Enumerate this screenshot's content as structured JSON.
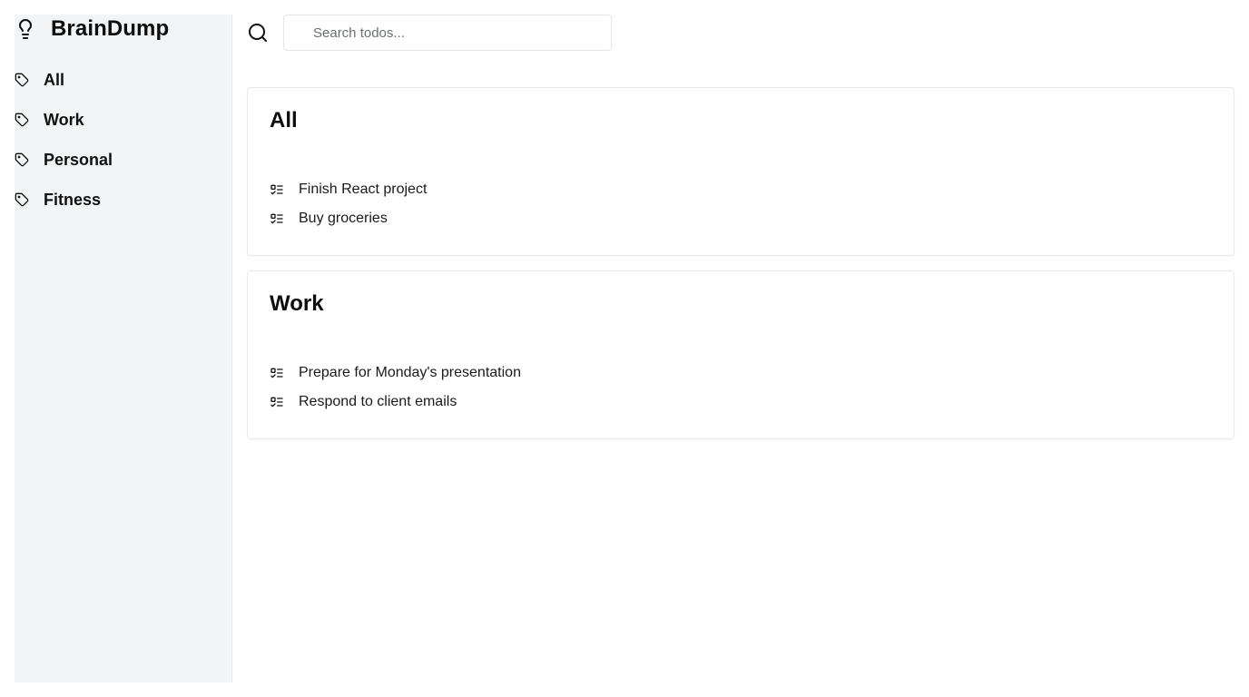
{
  "app": {
    "title": "BrainDump",
    "logo_icon": "lightbulb-icon"
  },
  "sidebar": {
    "items": [
      {
        "label": "All",
        "icon": "tag-icon"
      },
      {
        "label": "Work",
        "icon": "tag-icon"
      },
      {
        "label": "Personal",
        "icon": "tag-icon"
      },
      {
        "label": "Fitness",
        "icon": "tag-icon"
      }
    ]
  },
  "search": {
    "icon": "search-icon",
    "value": "",
    "placeholder": "Search todos..."
  },
  "sections": [
    {
      "title": "All",
      "todos": [
        {
          "text": "Finish React project",
          "icon": "list-todo-icon"
        },
        {
          "text": "Buy groceries",
          "icon": "list-todo-icon"
        }
      ]
    },
    {
      "title": "Work",
      "todos": [
        {
          "text": "Prepare for Monday's presentation",
          "icon": "list-todo-icon"
        },
        {
          "text": "Respond to client emails",
          "icon": "list-todo-icon"
        }
      ]
    }
  ],
  "colors": {
    "sidebar_bg": "#f2f4f6",
    "border": "#e6e8eb",
    "text": "#111111"
  }
}
